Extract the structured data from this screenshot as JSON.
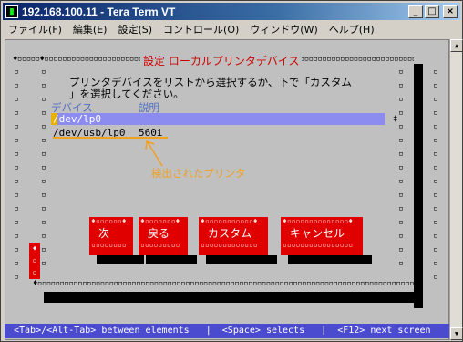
{
  "window": {
    "title": "192.168.100.11 - Tera Term VT"
  },
  "menu": {
    "items": [
      "ファイル(F)",
      "編集(E)",
      "設定(S)",
      "コントロール(O)",
      "ウィンドウ(W)",
      "ヘルプ(H)"
    ]
  },
  "dialog": {
    "title": "設定 ローカルプリンタデバイス",
    "description_line1": "プリンタデバイスをリストから選択するか、下で「カスタム",
    "description_line2": "」を選択してください。",
    "col_device": "デバイス",
    "col_desc": "説明",
    "rows": [
      {
        "device": "/dev/lp0",
        "desc": ""
      },
      {
        "device": "/dev/usb/lp0",
        "desc": "560i"
      }
    ],
    "annotation": "検出されたプリンタ",
    "buttons": {
      "next": "次",
      "back": "戻る",
      "custom": "カスタム",
      "cancel": "キャンセル"
    }
  },
  "statusbar": {
    "text": "<Tab>/<Alt-Tab> between elements   |  <Space> selects   |  <F12> next screen"
  },
  "colors": {
    "selection": "#8c8cf0",
    "button": "#e00000",
    "annotation": "#f0a020",
    "status": "#4b4bd0"
  }
}
